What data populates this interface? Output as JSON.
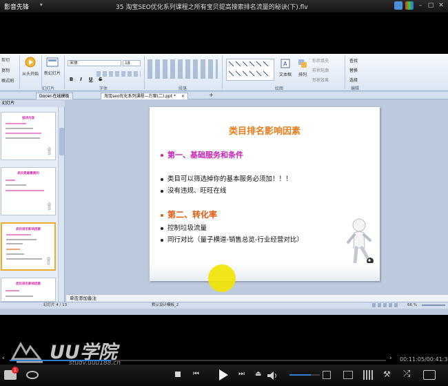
{
  "player": {
    "logo": "影音先锋",
    "file_title": "35 淘宝SEO优化系列课程之所有宝贝提高搜索排名流量的秘诀(下).flv",
    "watermark_brand": "UU学院",
    "watermark_url": "study.uuu188.cn",
    "time_display": "00:11:05/00:41:35",
    "progress": 0.27,
    "volume": 0.7,
    "badge_count": "1"
  },
  "ribbon": {
    "clipboard": {
      "cut": "剪切",
      "copy": "复制",
      "format": "格式刷"
    },
    "start_from": "从头开始",
    "new_slide": "新幻灯片",
    "font_name": "宋体",
    "font_size": "18",
    "format_buttons": [
      "B",
      "I",
      "U",
      "S"
    ],
    "group_slides": "幻灯片",
    "group_font": "字体",
    "group_para": "段落",
    "group_draw": "绘图",
    "group_edit": "编辑",
    "textbox": "文本框",
    "arrange": "排列",
    "shape_fill": "形状填充",
    "shape_outline": "形状轮廓",
    "shape_effect": "形状效果",
    "find": "查找",
    "replace": "替换",
    "select": "选择"
  },
  "tabs": [
    {
      "label": "Docer-在线模板",
      "active": false
    },
    {
      "label": "淘宝seo优化系列课程—方案(二).ppt *",
      "active": true
    }
  ],
  "panel": {
    "header": "幻灯片",
    "thumbs": [
      {
        "title": "描述内容"
      },
      {
        "title": "类目是最重要的"
      },
      {
        "title": "类目排名影响因素"
      },
      {
        "title": "类目排名影响因素"
      }
    ]
  },
  "slide": {
    "title": "类目排名影响因素",
    "section1": "第一、基础服务和条件",
    "bullets1": [
      "类目可以筛选掉你的基本服务必须加！！！",
      "没有违规、旺旺在线"
    ],
    "section2": "第二、转化率",
    "bullets2": [
      "控制垃圾流量",
      "同行对比（量子横道-销售总览-行业经营对比）"
    ]
  },
  "notes": "单击添加备注",
  "status": {
    "slide_info": "幻灯片 4 / 13",
    "theme": "默认设计模板_2",
    "zoom": "66 %"
  },
  "colors": {
    "section_magenta": "#c521b6",
    "section_orange": "#e35a0e",
    "title_orange": "#ea7c1c",
    "ribbon_bg": "#dbe6f4",
    "highlight": "#f2e400"
  }
}
